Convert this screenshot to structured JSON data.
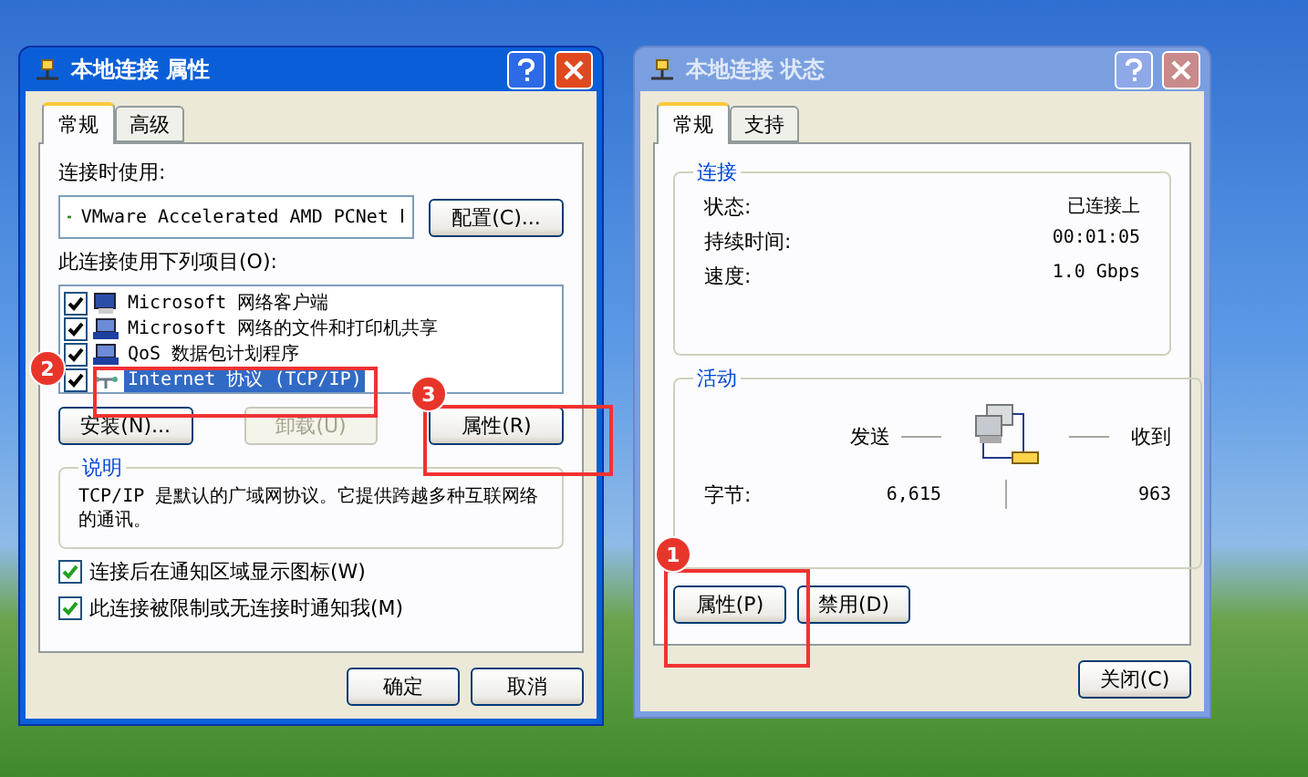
{
  "properties_dialog": {
    "title": "本地连接 属性",
    "active": true,
    "tabs": [
      {
        "label": "常规",
        "selected": true
      },
      {
        "label": "高级",
        "selected": false
      }
    ],
    "adapter_label": "连接时使用:",
    "adapter": "VMware Accelerated AMD PCNet Ⅰ",
    "configure_button": "配置(C)...",
    "items_label": "此连接使用下列项目(O):",
    "items": [
      {
        "label": "Microsoft 网络客户端",
        "kind": "client",
        "checked": true,
        "selected": false
      },
      {
        "label": "Microsoft 网络的文件和打印机共享",
        "kind": "service",
        "checked": true,
        "selected": false
      },
      {
        "label": "QoS 数据包计划程序",
        "kind": "service",
        "checked": true,
        "selected": false
      },
      {
        "label": "Internet 协议 (TCP/IP)",
        "kind": "protocol",
        "checked": true,
        "selected": true
      }
    ],
    "item_buttons": [
      {
        "label": "安装(N)...",
        "disabled": false
      },
      {
        "label": "卸载(U)",
        "disabled": true
      },
      {
        "label": "属性(R)",
        "disabled": false
      }
    ],
    "description": {
      "title": "说明",
      "text": "TCP/IP 是默认的广域网协议。它提供跨越多种互联网络的通讯。"
    },
    "options": [
      {
        "label": "连接后在通知区域显示图标(W)",
        "checked": true
      },
      {
        "label": "此连接被限制或无连接时通知我(M)",
        "checked": true
      }
    ],
    "buttons": [
      "确定",
      "取消"
    ],
    "callouts": [
      {
        "number": "2"
      },
      {
        "number": "3"
      }
    ]
  },
  "status_dialog": {
    "title": "本地连接 状态",
    "active": false,
    "tabs": [
      {
        "label": "常规",
        "selected": true
      },
      {
        "label": "支持",
        "selected": false
      }
    ],
    "connection": {
      "title": "连接",
      "rows": [
        {
          "label": "状态:",
          "value": "已连接上"
        },
        {
          "label": "持续时间:",
          "value": "00:01:05"
        },
        {
          "label": "速度:",
          "value": "1.0 Gbps"
        }
      ]
    },
    "activity": {
      "title": "活动",
      "sent_label": "发送",
      "received_label": "收到",
      "bytes_label": "字节:",
      "sent": "6,615",
      "received": "963"
    },
    "buttons": [
      {
        "label": "属性(P)"
      },
      {
        "label": "禁用(D)"
      }
    ],
    "close_button": "关闭(C)",
    "callouts": [
      {
        "number": "1"
      }
    ]
  }
}
